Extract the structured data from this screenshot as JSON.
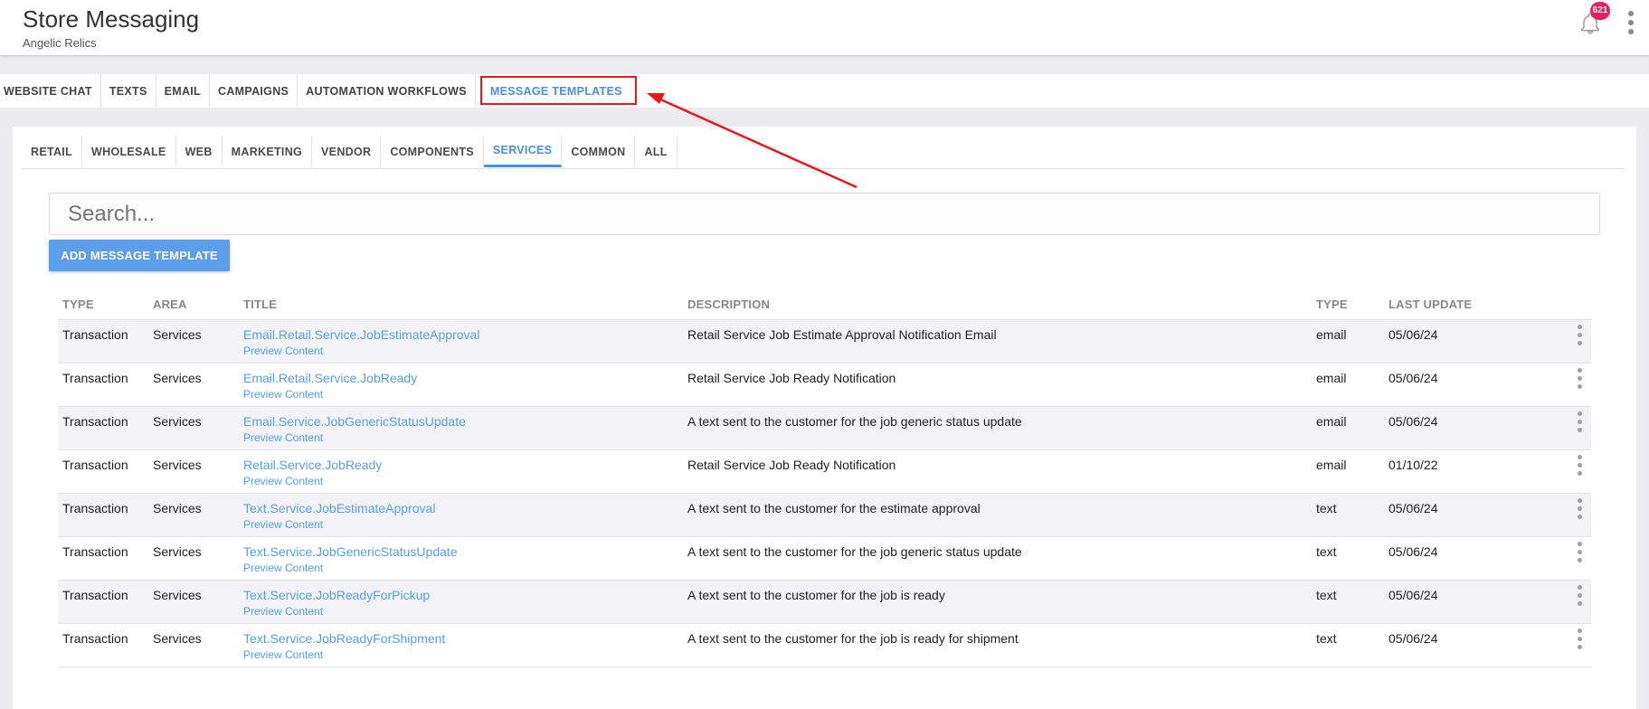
{
  "header": {
    "title": "Store Messaging",
    "subtitle": "Angelic Relics",
    "notification_count": "621"
  },
  "top_tabs": [
    {
      "label": "WEBSITE CHAT"
    },
    {
      "label": "TEXTS"
    },
    {
      "label": "EMAIL"
    },
    {
      "label": "CAMPAIGNS"
    },
    {
      "label": "AUTOMATION WORKFLOWS"
    },
    {
      "label": "MESSAGE TEMPLATES",
      "active": true
    }
  ],
  "sub_tabs": [
    {
      "label": "RETAIL"
    },
    {
      "label": "WHOLESALE"
    },
    {
      "label": "WEB"
    },
    {
      "label": "MARKETING"
    },
    {
      "label": "VENDOR"
    },
    {
      "label": "COMPONENTS"
    },
    {
      "label": "SERVICES",
      "active": true
    },
    {
      "label": "COMMON"
    },
    {
      "label": "ALL"
    }
  ],
  "search": {
    "placeholder": "Search...",
    "value": ""
  },
  "add_button_label": "ADD MESSAGE TEMPLATE",
  "table": {
    "columns": [
      "TYPE",
      "AREA",
      "TITLE",
      "DESCRIPTION",
      "TYPE",
      "LAST UPDATE"
    ],
    "preview_label": "Preview Content",
    "rows": [
      {
        "type": "Transaction",
        "area": "Services",
        "title": "Email.Retail.Service.JobEstimateApproval",
        "description": "Retail Service Job Estimate Approval Notification Email",
        "channel": "email",
        "last_update": "05/06/24"
      },
      {
        "type": "Transaction",
        "area": "Services",
        "title": "Email.Retail.Service.JobReady",
        "description": "Retail Service Job Ready Notification",
        "channel": "email",
        "last_update": "05/06/24"
      },
      {
        "type": "Transaction",
        "area": "Services",
        "title": "Email.Service.JobGenericStatusUpdate",
        "description": "A text sent to the customer for the job generic status update",
        "channel": "email",
        "last_update": "05/06/24"
      },
      {
        "type": "Transaction",
        "area": "Services",
        "title": "Retail.Service.JobReady",
        "description": "Retail Service Job Ready Notification",
        "channel": "email",
        "last_update": "01/10/22"
      },
      {
        "type": "Transaction",
        "area": "Services",
        "title": "Text.Service.JobEstimateApproval",
        "description": "A text sent to the customer for the estimate approval",
        "channel": "text",
        "last_update": "05/06/24"
      },
      {
        "type": "Transaction",
        "area": "Services",
        "title": "Text.Service.JobGenericStatusUpdate",
        "description": "A text sent to the customer for the job generic status update",
        "channel": "text",
        "last_update": "05/06/24"
      },
      {
        "type": "Transaction",
        "area": "Services",
        "title": "Text.Service.JobReadyForPickup",
        "description": "A text sent to the customer for the job is ready",
        "channel": "text",
        "last_update": "05/06/24"
      },
      {
        "type": "Transaction",
        "area": "Services",
        "title": "Text.Service.JobReadyForShipment",
        "description": "A text sent to the customer for the job is ready for shipment",
        "channel": "text",
        "last_update": "05/06/24"
      }
    ]
  },
  "colors": {
    "accent": "#5b9ee9",
    "highlight": "#e8191c",
    "badge": "#e91e63"
  },
  "icons": [
    "bell-icon",
    "kebab-menu-icon",
    "row-menu-icon"
  ]
}
